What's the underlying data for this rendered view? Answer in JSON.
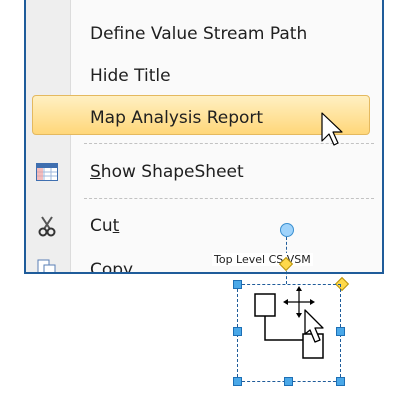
{
  "context_menu": {
    "items": [
      {
        "label": "Define Value Stream Path",
        "icon": ""
      },
      {
        "label": "Hide Title",
        "icon": ""
      },
      {
        "label": "Map Analysis Report",
        "icon": "",
        "highlighted": true
      },
      {
        "label_prefix": "S",
        "label_rest": "how ShapeSheet",
        "icon": "shapesheet-grid-icon"
      },
      {
        "label_main": "Cu",
        "label_underlined": "t",
        "icon": "scissors-icon"
      },
      {
        "label": "Copy",
        "icon": "copy-icon"
      }
    ]
  },
  "shape": {
    "title": "Top Level CS VSM"
  },
  "colors": {
    "highlight_top": "#fff0c2",
    "highlight_bottom": "#ffd77a",
    "menu_border": "#1f5c9a",
    "handle": "#4aa8e8",
    "control_point": "#ffd94a"
  }
}
